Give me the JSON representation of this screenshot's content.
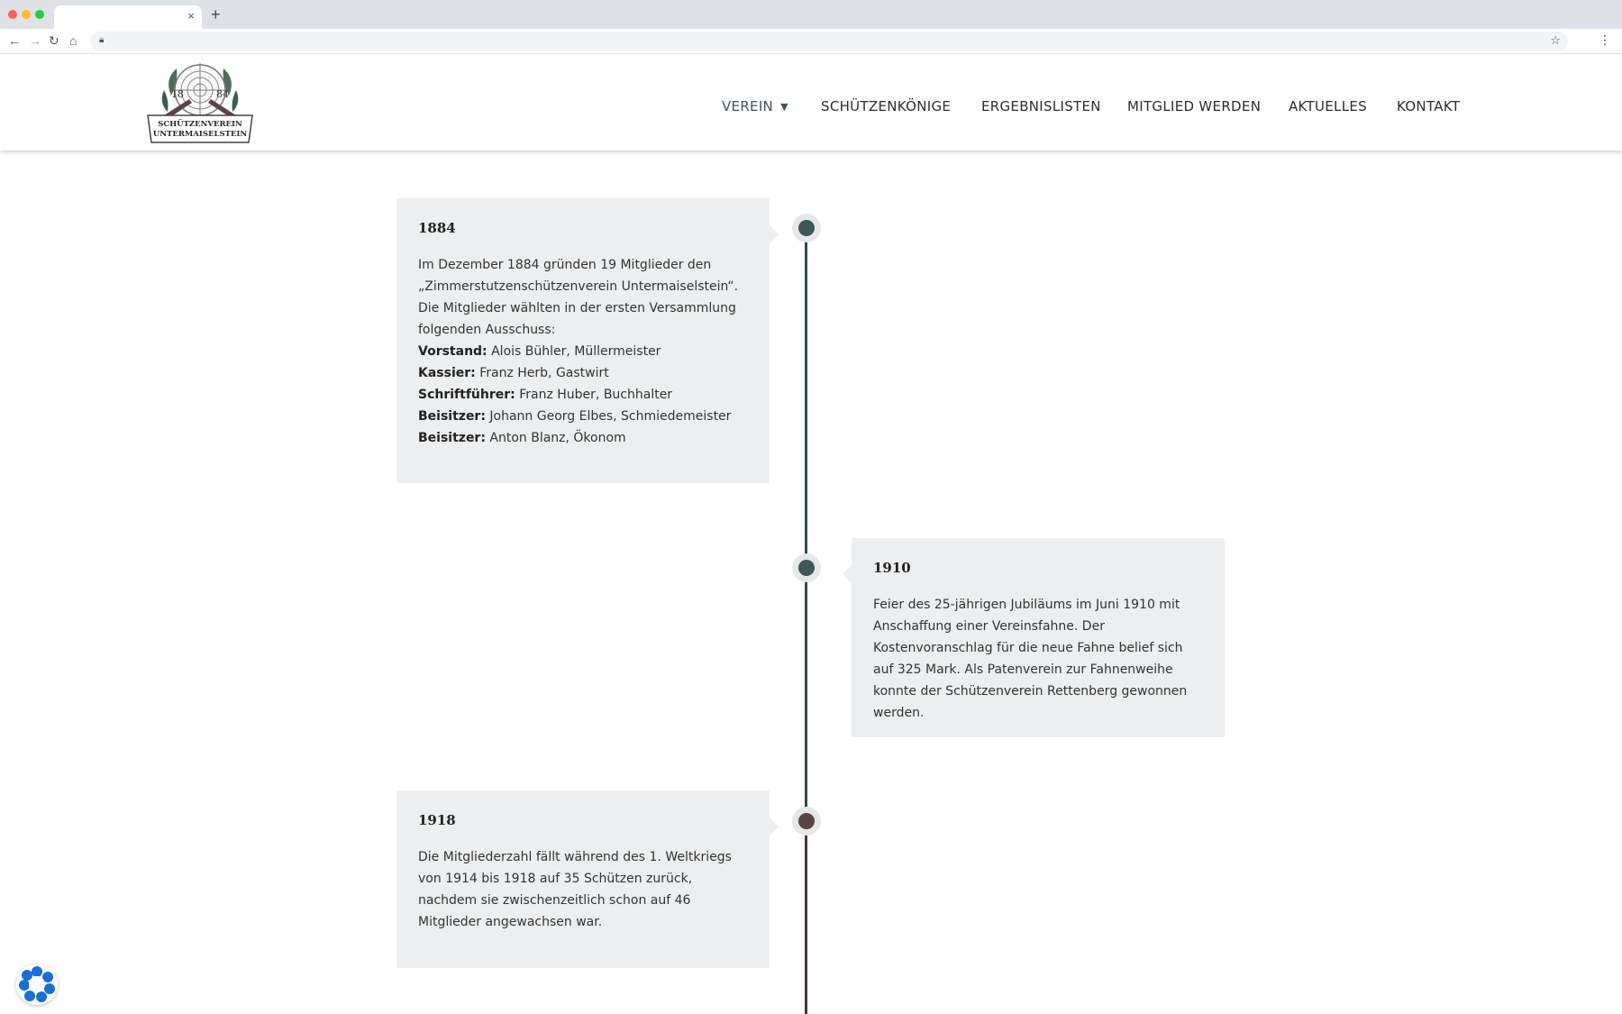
{
  "browser": {
    "tab_close": "×",
    "new_tab": "+"
  },
  "header": {
    "logo": {
      "year_left": "18",
      "year_right": "84",
      "line1": "SCHÜTZENVEREIN",
      "line2": "UNTERMAISELSTEIN"
    },
    "nav": [
      {
        "label": "VEREIN",
        "active": true,
        "has_dropdown": true
      },
      {
        "label": "SCHÜTZENKÖNIGE"
      },
      {
        "label": "ERGEBNISLISTEN"
      },
      {
        "label": "MITGLIED WERDEN"
      },
      {
        "label": "AKTUELLES"
      },
      {
        "label": "KONTAKT"
      }
    ]
  },
  "colors": {
    "accent": "#3d5858",
    "node_dark_green": "#3d5858",
    "node_brown": "#5b4443",
    "card_bg": "#edeeef",
    "line_green": "#2f4a4c",
    "line_brown": "#4e3635"
  },
  "timeline": [
    {
      "year": "1884",
      "intro": "Im Dezember 1884 gründen 19 Mitglieder den „Zimmerstutzenschützenverein Untermaiselstein“. Die Mitglieder wählten in der ersten Versammlung folgenden Ausschuss:",
      "roles": [
        {
          "role": "Vorstand:",
          "name": "Alois Bühler, Müllermeister"
        },
        {
          "role": "Kassier:",
          "name": "Franz Herb, Gastwirt"
        },
        {
          "role": "Schriftführer:",
          "name": "Franz Huber, Buchhalter"
        },
        {
          "role": "Beisitzer:",
          "name": "Johann Georg Elbes, Schmiedemeister"
        },
        {
          "role": "Beisitzer:",
          "name": "Anton Blanz, Ökonom"
        }
      ]
    },
    {
      "year": "1910",
      "text": "Feier des 25-jährigen Jubiläums im Juni 1910 mit Anschaffung einer Vereinsfahne. Der Kostenvoranschlag für die neue Fahne belief sich auf 325 Mark. Als Patenverein zur Fahnenweihe konnte der Schützenverein Rettenberg gewonnen werden."
    },
    {
      "year": "1918",
      "text": "Die Mitgliederzahl fällt während des 1. Weltkriegs von 1914 bis 1918 auf 35 Schützen zurück, nachdem sie zwischenzeitlich schon auf 46 Mitglieder angewachsen war."
    }
  ]
}
